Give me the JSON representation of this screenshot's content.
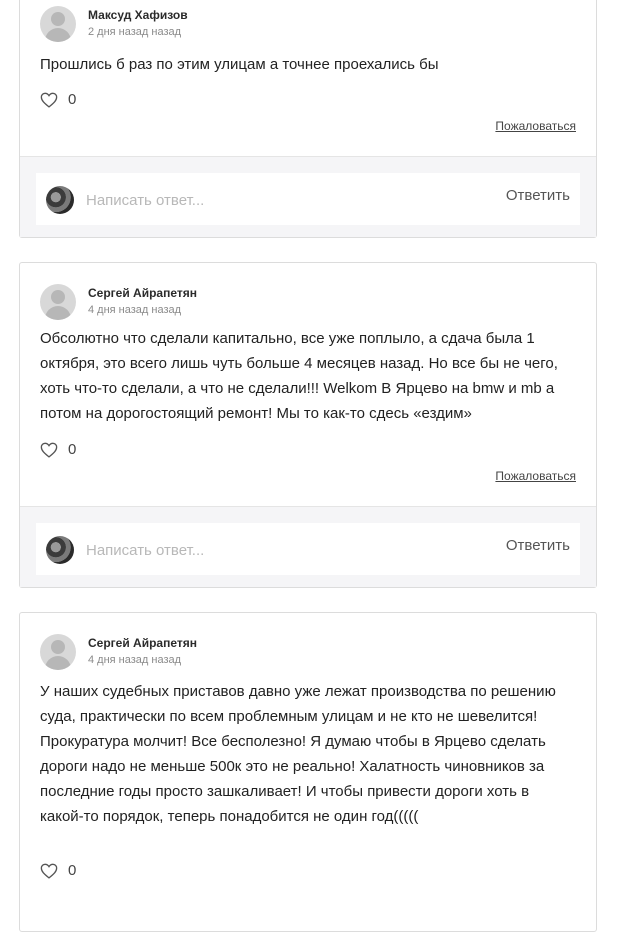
{
  "comments": [
    {
      "author": "Максуд Хафизов",
      "time": "2 дня назад назад",
      "text": "Прошлись б раз по этим улицам а точнее проехались бы",
      "likes": "0",
      "report": "Пожаловаться"
    },
    {
      "author": "Сергей Айрапетян",
      "time": "4 дня назад назад",
      "text": "Обсолютно что сделали капитально, все уже поплыло, а сдача была 1 октября, это всего лишь чуть больше 4 месяцев назад. Но все бы не чего, хоть что-то сделали, а что не сделали!!! Welkom В Ярцево на bmw и mb а потом на дорогостоящий ремонт! Мы то как-то сдесь «ездим»",
      "likes": "0",
      "report": "Пожаловаться"
    },
    {
      "author": "Сергей Айрапетян",
      "time": "4 дня назад назад",
      "text": "У наших судебных приставов давно уже лежат производства по решению суда, практически по всем проблемным улицам и не кто не шевелится! Прокуратура молчит! Все бесполезно! Я думаю чтобы в Ярцево сделать дороги надо не меньше 500к это не реально! Халатность чиновников за последние годы просто зашкаливает! И чтобы привести дороги хоть в какой-то порядок, теперь понадобится не один год(((((",
      "likes": "0"
    }
  ],
  "reply": {
    "placeholder": "Написать ответ...",
    "button": "Ответить"
  },
  "icons": {
    "like": "heart-outline-icon",
    "avatar": "user-placeholder-icon"
  }
}
